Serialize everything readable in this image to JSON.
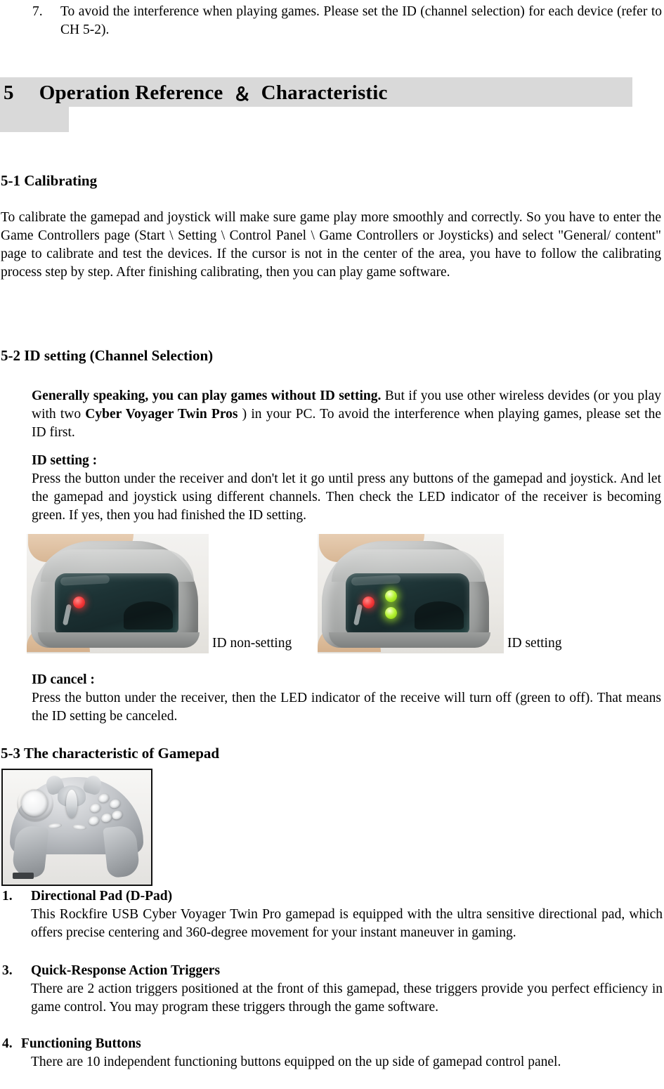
{
  "top_item": {
    "number": "7.",
    "text": "To avoid the interference when playing games. Please set the ID (channel selection) for each device (refer to CH 5-2)."
  },
  "chapter": {
    "number": "5",
    "title": "Operation Reference",
    "ampersand": "＆",
    "subtitle": "Characteristic"
  },
  "section_5_1": {
    "heading": "5-1 Calibrating",
    "body": "To calibrate the gamepad and joystick will make sure game play more smoothly and correctly. So you have to enter the Game Controllers page (Start \\ Setting \\ Control Panel \\ Game Controllers or Joysticks) and select \"General/ content\" page to calibrate and test the devices. If the cursor is not in the center of the area, you have to follow the calibrating process step by step. After finishing calibrating, then you can play game software."
  },
  "section_5_2": {
    "heading": "5-2 ID setting (Channel Selection)",
    "intro_bold": "Generally speaking, you can play games without ID setting.",
    "intro_rest_1": " But if you use other wireless devides (or you play with two ",
    "intro_bold_2": "Cyber Voyager Twin Pros",
    "intro_rest_2": " ) in your PC. To avoid the interference when playing games, please set the ID first.",
    "id_setting_label": "ID setting :",
    "id_setting_body": "Press the button under the receiver and don't let it go until press any buttons of the gamepad and joystick. And let the gamepad and joystick using different channels. Then check the LED indicator of the receiver is becoming green. If yes, then you had finished the ID setting.",
    "photo_caption_left": "ID non-setting",
    "photo_caption_right": "ID setting",
    "id_cancel_label": "ID cancel :",
    "id_cancel_body": "Press the button under the receiver, then the LED indicator of the receive will turn off (green to off). That means the ID setting be canceled."
  },
  "section_5_3": {
    "heading": "5-3 The characteristic of Gamepad",
    "features": [
      {
        "number": "1.",
        "title": "Directional Pad (D-Pad)",
        "body": "This Rockfire USB Cyber Voyager Twin Pro gamepad is equipped with the ultra sensitive directional pad, which offers precise centering and 360-degree movement for your instant maneuver in gaming."
      },
      {
        "number": "3.",
        "title": "Quick-Response Action Triggers",
        "body": "There are 2 action triggers positioned at the front of this gamepad, these triggers provide you perfect efficiency in game control. You may program these triggers through the game software."
      },
      {
        "number": "4.",
        "title": "Functioning Buttons",
        "body": "There are 10 independent functioning buttons equipped on the up side of gamepad control panel."
      }
    ]
  },
  "colors": {
    "banner_gray": "#d9d9d9",
    "led_red": "#f73b3b",
    "led_green": "#b9f53a",
    "text": "#000000"
  }
}
